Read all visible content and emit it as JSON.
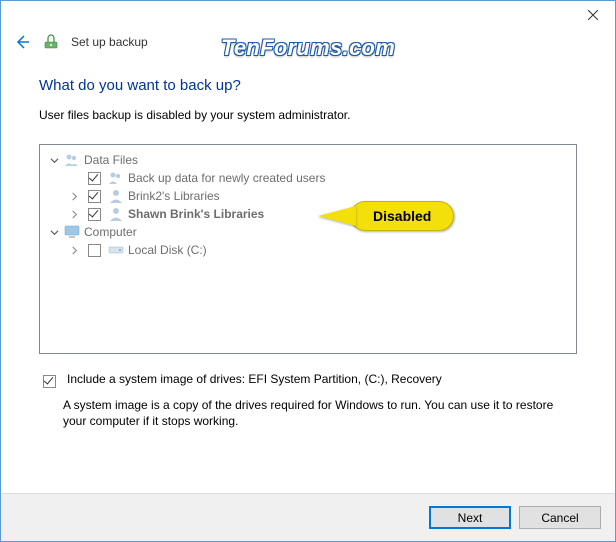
{
  "window": {
    "title": "Set up backup"
  },
  "watermark": "TenForums.com",
  "heading": "What do you want to back up?",
  "subtext": "User files backup is disabled by your system administrator.",
  "tree": {
    "data_files": {
      "label": "Data Files",
      "items": [
        {
          "label": "Back up data for newly created users",
          "checked": true
        },
        {
          "label": "Brink2's Libraries",
          "checked": true
        },
        {
          "label": "Shawn Brink's Libraries",
          "checked": true,
          "bold": true
        }
      ]
    },
    "computer": {
      "label": "Computer",
      "items": [
        {
          "label": "Local Disk (C:)",
          "checked": false
        }
      ]
    }
  },
  "callout": "Disabled",
  "system_image": {
    "checkbox_label": "Include a system image of drives: EFI System Partition, (C:), Recovery",
    "checked": true,
    "description": "A system image is a copy of the drives required for Windows to run. You can use it to restore your computer if it stops working."
  },
  "buttons": {
    "next": "Next",
    "cancel": "Cancel"
  }
}
